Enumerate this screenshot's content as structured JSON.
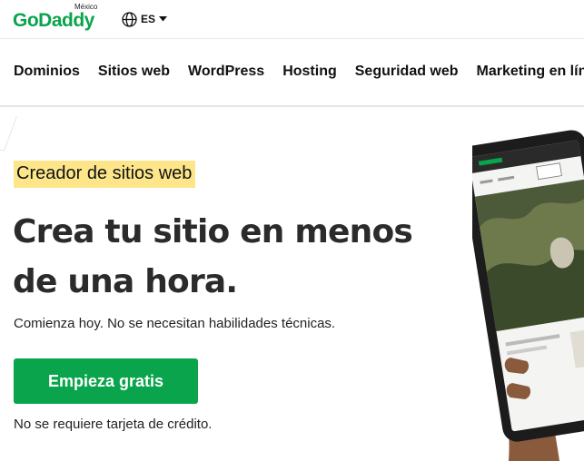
{
  "header": {
    "logo_text": "GoDaddy",
    "logo_region": "México",
    "language": "ES",
    "globe_icon": "globe-icon",
    "caret_icon": "caret-down-icon"
  },
  "nav": {
    "items": [
      {
        "label": "Dominios"
      },
      {
        "label": "Sitios web"
      },
      {
        "label": "WordPress"
      },
      {
        "label": "Hosting"
      },
      {
        "label": "Seguridad web"
      },
      {
        "label": "Marketing en línea"
      }
    ]
  },
  "hero": {
    "eyebrow": "Creador de sitios web",
    "headline_line1": "Crea tu sitio en menos",
    "headline_line2": "de una hora.",
    "subtext": "Comienza hoy. No se necesitan habilidades técnicas.",
    "cta_label": "Empieza gratis",
    "note": "No se requiere tarjeta de crédito."
  },
  "colors": {
    "brand_green": "#09a44b",
    "highlight": "#fde68a",
    "headline": "#2b2b2b"
  }
}
